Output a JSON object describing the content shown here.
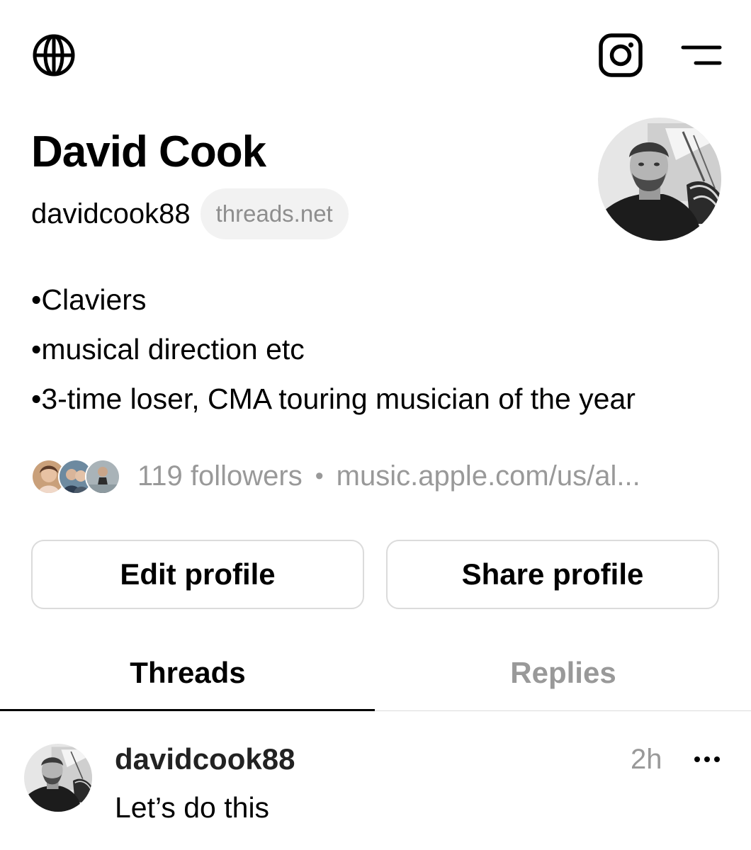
{
  "top_bar": {
    "left_icon": "globe-icon",
    "right_icons": [
      "instagram-icon",
      "menu-icon"
    ]
  },
  "profile": {
    "name": "David Cook",
    "handle": "davidcook88",
    "domain_badge": "threads.net",
    "avatar": "profile-photo"
  },
  "bio": {
    "lines": [
      "•Claviers",
      "•musical direction etc",
      "•3-time loser, CMA touring musician of the year"
    ]
  },
  "followers": {
    "count_text": "119 followers",
    "separator": "•",
    "link": "music.apple.com/us/al..."
  },
  "actions": {
    "edit_label": "Edit profile",
    "share_label": "Share profile"
  },
  "tabs": [
    {
      "label": "Threads",
      "active": true
    },
    {
      "label": "Replies",
      "active": false
    }
  ],
  "post": {
    "username": "davidcook88",
    "time": "2h",
    "text": "Let’s do this",
    "more_icon": "more-icon"
  }
}
